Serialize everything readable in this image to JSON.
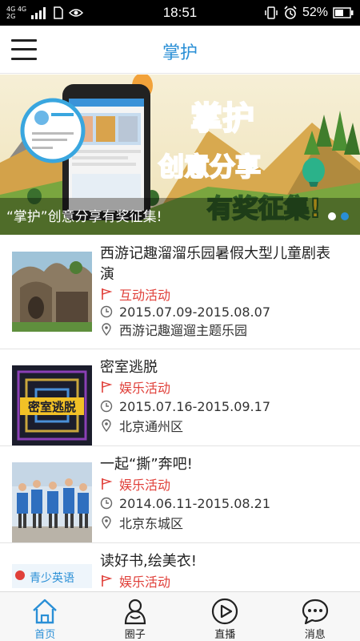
{
  "status_bar": {
    "network_top": "4G 4G",
    "network_bottom": "2G",
    "time": "18:51",
    "battery": "52%"
  },
  "header": {
    "title": "掌护",
    "menu_icon": "menu-icon"
  },
  "banner": {
    "caption": "“掌护”创意分享有奖征集!",
    "art_title_line1": "掌护",
    "art_title_line2": "创意分享",
    "art_title_line3": "有奖征集!",
    "dots": 2,
    "active_dot": 2
  },
  "events": [
    {
      "title": "西游记趣溜溜乐园暑假大型儿童剧表演",
      "category": "互动活动",
      "dates": "2015.07.09-2015.08.07",
      "location": "西游记趣遛遛主题乐园"
    },
    {
      "title": "密室逃脱",
      "category": "娱乐活动",
      "dates": "2015.07.16-2015.09.17",
      "location": "北京通州区",
      "thumb_text": "密室逃脱"
    },
    {
      "title": "一起“撕”奔吧!",
      "category": "娱乐活动",
      "dates": "2014.06.11-2015.08.21",
      "location": "北京东城区"
    },
    {
      "title": "读好书,绘美衣!",
      "category": "娱乐活动",
      "thumb_text": "青少英语"
    }
  ],
  "tabs": [
    {
      "label": "首页",
      "icon": "home-icon",
      "active": true
    },
    {
      "label": "圈子",
      "icon": "circle-group-icon",
      "active": false
    },
    {
      "label": "直播",
      "icon": "play-icon",
      "active": false
    },
    {
      "label": "消息",
      "icon": "message-icon",
      "active": false
    }
  ],
  "colors": {
    "accent": "#2a8fd6",
    "category": "#e0403a"
  }
}
